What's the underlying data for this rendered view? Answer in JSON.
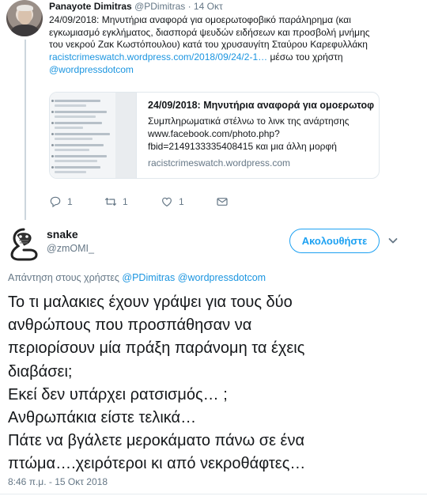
{
  "parent_tweet": {
    "name": "Panayote Dimitras",
    "handle": "@PDimitras",
    "separator": " · ",
    "date": "14 Οκτ",
    "text_lines": [
      "24/09/2018: Μηνυτήρια αναφορά για ομοερωτοφοβικό παράληρημα (και",
      "εγκωμιασμό εγκλήματος, διασπορά ψευδών ειδήσεων και προσβολή μνήμης",
      "του νεκρού Ζακ Κωστόπουλου) κατά του χρυσαυγίτη Σταύρου Καρεφυλλάκη"
    ],
    "link": "racistcrimeswatch.wordpress.com/2018/09/24/2-1…",
    "via_text": " μέσω του χρήστη",
    "via_user": "@wordpressdotcom",
    "card": {
      "title": "24/09/2018: Μηνυτήρια αναφορά για ομοερωτοφοβ…",
      "description": "Συμπληρωματικά στέλνω το λινκ της ανάρτησης www.facebook.com/photo.php?fbid=2149133335408415 και μια άλλη μορφή",
      "domain": "racistcrimeswatch.wordpress.com"
    },
    "actions": {
      "replies": "1",
      "retweets": "1",
      "likes": "1",
      "icons": [
        "reply-icon",
        "retweet-icon",
        "like-icon",
        "message-icon"
      ]
    }
  },
  "reply_tweet": {
    "name": "snake",
    "handle": "@zmOMI_",
    "follow_label": "Ακολουθήστε",
    "replying_prefix": "Απάντηση στους χρήστες ",
    "replying_to": [
      "@PDimitras",
      "@wordpressdotcom"
    ],
    "text": "Το τι μαλακιες έχουν γράψει για τους δύο\nανθρώπους που προσπάθησαν να\nπεριορίσουν μία πράξη παράνομη τα έχεις\nδιαβάσει;\nΕκεί δεν υπάρχει ρατσισμός… ;\nΑνθρωπάκια είστε τελικά…\nΠάτε να βγάλετε μεροκάματο πάνω σε ένα\nπτώμα….χειρότεροι κι από νεκροθάφτες…",
    "timestamp": "8:46 π.μ. - 15 Οκτ 2018"
  },
  "colors": {
    "link": "#1b95e0",
    "follow": "#1da1f2",
    "muted": "#657786",
    "text": "#14171a"
  }
}
